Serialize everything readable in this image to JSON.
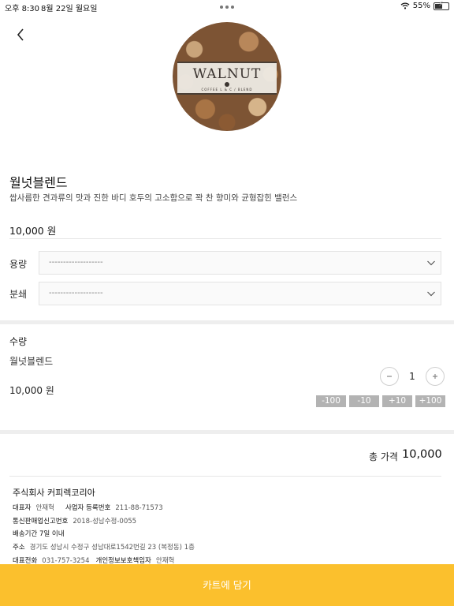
{
  "status_bar": {
    "time": "오후 8:30",
    "date": "8월 22일 월요일",
    "battery": "55%",
    "battery_level": 0.55
  },
  "product": {
    "logo_title": "WALNUT",
    "logo_subtitle": "COFFEE L & C / BLEND",
    "name": "월넛블렌드",
    "description": "쌉사름한 견과류의 맛과 진한 바디 호두의 고소함으로 꽉 찬 향미와 균형잡힌 밸런스",
    "price": "10,000 원"
  },
  "options": [
    {
      "label": "용량",
      "value": "-------------------"
    },
    {
      "label": "분쇄",
      "value": "-------------------"
    }
  ],
  "quantity": {
    "title": "수량",
    "item_name": "월넛블렌드",
    "item_price": "10,000 원",
    "value": "1",
    "minus": "−",
    "plus": "+",
    "adjust_buttons": [
      "-100",
      "-10",
      "+10",
      "+100"
    ]
  },
  "total": {
    "label": "총 가격",
    "value": "10,000"
  },
  "company": {
    "name": "주식회사 커피렉코리아",
    "ceo_label": "대표자",
    "ceo_value": "안재혁",
    "bizno_label": "사업자 등록번호",
    "bizno_value": "211-88-71573",
    "mail_order_label": "통신판매업신고번호",
    "mail_order_value": "2018-성남수정-0055",
    "delivery_label": "배송기간 7일 이내",
    "address_label": "주소",
    "address_value": "경기도 성남시 수정구 성남대로1542번길 23 (복정동) 1층",
    "phone_label": "대표전화",
    "phone_value": "031-757-3254",
    "privacy_label": "개인정보보호책임자",
    "privacy_value": "안재혁"
  },
  "cart_button": "카트에 담기",
  "colors": {
    "accent": "#fbc02d",
    "adjust_button": "#b3b3b3"
  }
}
